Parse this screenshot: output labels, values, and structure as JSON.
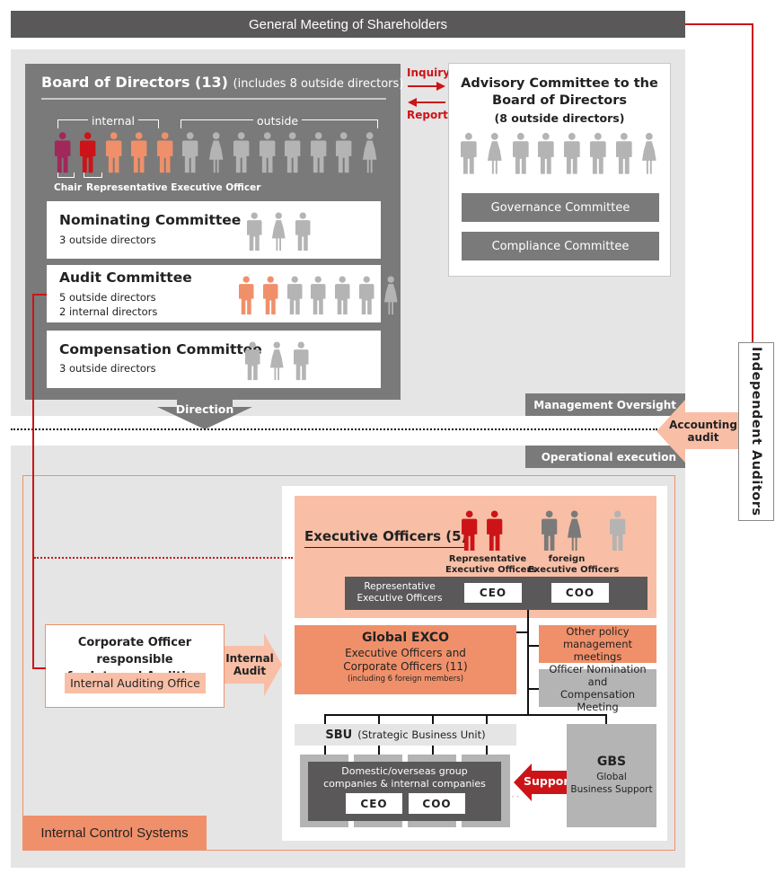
{
  "general_meeting": "General Meeting of Shareholders",
  "board": {
    "title": "Board of Directors (13)",
    "subtitle": "(includes 8 outside directors)",
    "internal_label": "internal",
    "outside_label": "outside",
    "chair_label": "Chair",
    "rep_label": "Representative Executive Officer",
    "members": [
      {
        "role": "chair",
        "gender": "male",
        "color": "#a0285a"
      },
      {
        "role": "representative",
        "gender": "male",
        "color": "#cc1418"
      },
      {
        "role": "internal",
        "gender": "male",
        "color": "#f0906a"
      },
      {
        "role": "internal",
        "gender": "male",
        "color": "#f0906a"
      },
      {
        "role": "internal",
        "gender": "male",
        "color": "#f0906a"
      },
      {
        "role": "outside",
        "gender": "male",
        "color": "#b4b4b4"
      },
      {
        "role": "outside",
        "gender": "female",
        "color": "#b4b4b4"
      },
      {
        "role": "outside",
        "gender": "male",
        "color": "#b4b4b4"
      },
      {
        "role": "outside",
        "gender": "male",
        "color": "#b4b4b4"
      },
      {
        "role": "outside",
        "gender": "male",
        "color": "#b4b4b4"
      },
      {
        "role": "outside",
        "gender": "male",
        "color": "#b4b4b4"
      },
      {
        "role": "outside",
        "gender": "male",
        "color": "#b4b4b4"
      },
      {
        "role": "outside",
        "gender": "female",
        "color": "#b4b4b4"
      }
    ],
    "committees": [
      {
        "title": "Nominating Committee",
        "lines": [
          "3 outside directors"
        ],
        "people": [
          "m",
          "f",
          "m"
        ],
        "colors": [
          "#b4b4b4",
          "#b4b4b4",
          "#b4b4b4"
        ]
      },
      {
        "title": "Audit Committee",
        "lines": [
          "5 outside directors",
          "2 internal directors"
        ],
        "people": [
          "m",
          "m",
          "m",
          "m",
          "m",
          "m",
          "f"
        ],
        "colors": [
          "#f0906a",
          "#f0906a",
          "#b4b4b4",
          "#b4b4b4",
          "#b4b4b4",
          "#b4b4b4",
          "#b4b4b4"
        ]
      },
      {
        "title": "Compensation Committee",
        "lines": [
          "3 outside directors"
        ],
        "people": [
          "m",
          "f",
          "m"
        ],
        "colors": [
          "#b4b4b4",
          "#b4b4b4",
          "#b4b4b4"
        ]
      }
    ]
  },
  "inquiry_label": "Inquiry",
  "report_label": "Report",
  "advisory": {
    "title_line1": "Advisory Committee to the",
    "title_line2": "Board of Directors",
    "subtitle": "(8 outside directors)",
    "people": [
      "m",
      "f",
      "m",
      "m",
      "m",
      "m",
      "m",
      "f"
    ],
    "governance": "Governance Committee",
    "compliance": "Compliance Committee"
  },
  "direction_label": "Direction",
  "management_oversight": "Management Oversight",
  "operational_execution": "Operational execution",
  "accounting_audit_line1": "Accounting",
  "accounting_audit_line2": "audit",
  "independent_auditors": "Independent Auditors",
  "executive": {
    "title": "Executive Officers (5)",
    "rep_caption_1": "Representative",
    "rep_caption_2": "Executive Officers",
    "foreign_caption_1": "foreign",
    "foreign_caption_2": "Executive Officers",
    "rep_bar_label_1": "Representative",
    "rep_bar_label_2": "Executive Officers",
    "ceo": "CEO",
    "coo": "COO",
    "people_colors": [
      "#cc1418",
      "#cc1418",
      "#7a7a7a",
      "#7a7a7a",
      "#b4b4b4"
    ],
    "people_genders": [
      "m",
      "m",
      "m",
      "f",
      "m"
    ]
  },
  "global_exco": {
    "title": "Global EXCO",
    "line1": "Executive Officers and",
    "line2": "Corporate Officers (11)",
    "note": "(including 6 foreign members)"
  },
  "other_policy_1": "Other policy",
  "other_policy_2": "management meetings",
  "officer_nom_1": "Officer Nomination and",
  "officer_nom_2": "Compensation Meeting",
  "sbu": {
    "abbr": "SBU",
    "full": "(Strategic Business Unit)"
  },
  "group_companies": {
    "line1": "Domestic/overseas group",
    "line2": "companies & internal companies",
    "ceo": "CEO",
    "coo": "COO"
  },
  "support_label": "Support",
  "gbs": {
    "abbr": "GBS",
    "line1": "Global",
    "line2": "Business Support"
  },
  "corporate_officer": {
    "line1": "Corporate Officer responsible",
    "line2": "for Internal Auditing",
    "office": "Internal Auditing Office"
  },
  "internal_audit_1": "Internal",
  "internal_audit_2": "Audit",
  "internal_control": "Internal Control Systems",
  "colors": {
    "dark_gray": "#5a5858",
    "mid_gray": "#7a7a7a",
    "light_gray": "#b4b4b4",
    "bg_gray": "#e5e5e5",
    "red": "#cc1418",
    "orange": "#f0906a",
    "peach": "#f8bfa6",
    "plum": "#a0285a"
  }
}
